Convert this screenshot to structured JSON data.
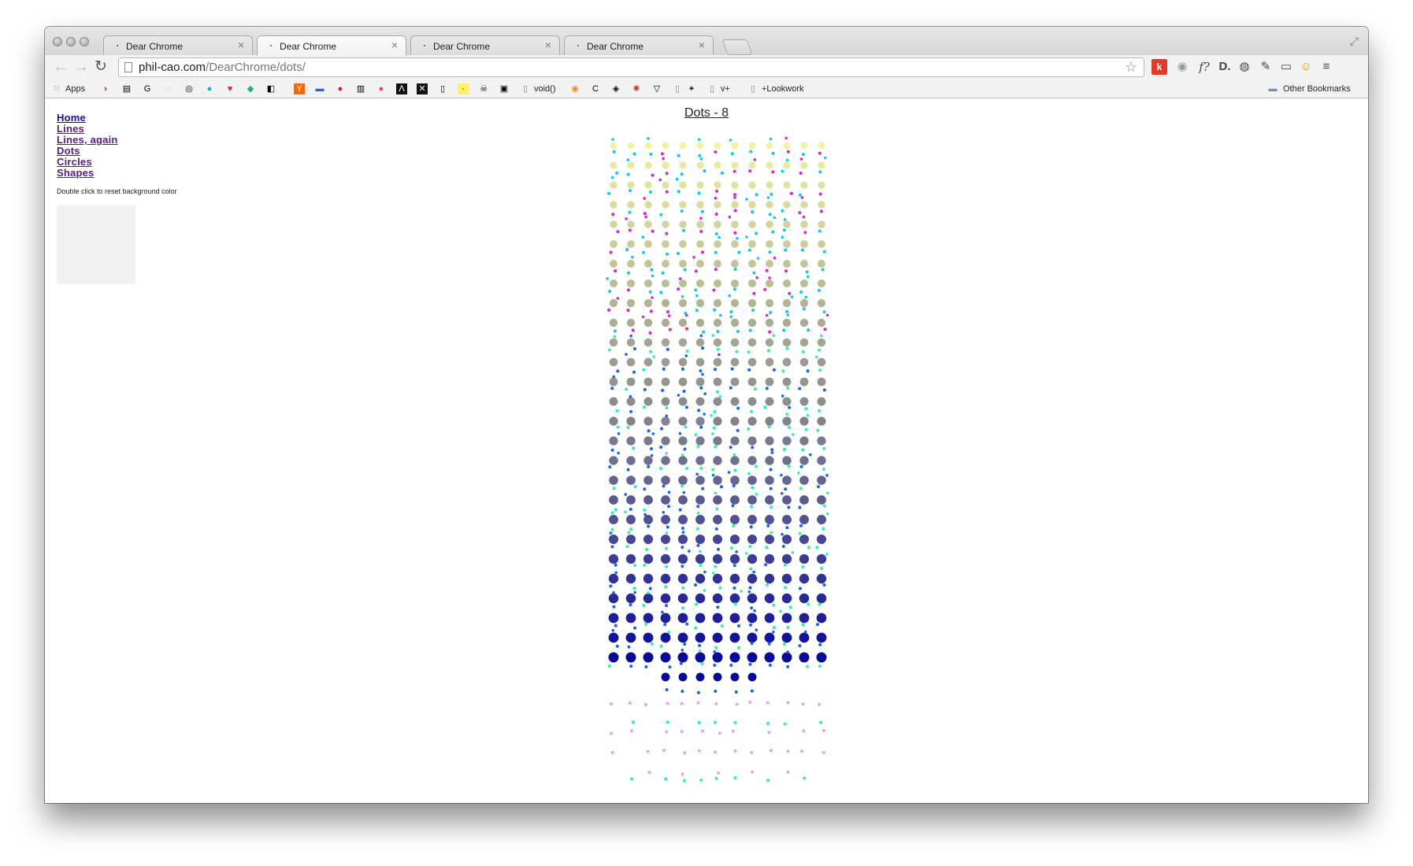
{
  "browser": {
    "tabs": [
      {
        "title": "Dear Chrome",
        "active": false
      },
      {
        "title": "Dear Chrome",
        "active": true
      },
      {
        "title": "Dear Chrome",
        "active": false
      },
      {
        "title": "Dear Chrome",
        "active": false
      }
    ],
    "url_host": "phil-cao.com",
    "url_path": "/DearChrome/dots/",
    "bookmarks": {
      "apps": "Apps",
      "void": "void()",
      "vplus": "v+",
      "lookwork": "+Lookwork",
      "other": "Other Bookmarks"
    }
  },
  "page": {
    "nav": [
      "Home",
      "Lines",
      "Lines, again",
      "Dots",
      "Circles",
      "Shapes"
    ],
    "hint": "Double click to reset background color",
    "heading": "Dots - 8",
    "swatch_color": "#f1f1f1"
  },
  "dots_colors": {
    "top": "#f1f2a4",
    "mid": "#8d8d8d",
    "bottom": "#0a0a9a",
    "accent_cyan": "#11c8e8",
    "accent_magenta": "#e020d0",
    "accent_blue": "#1565e8",
    "accent_green": "#2af5a0",
    "accent_pink": "#e8a0f0"
  }
}
